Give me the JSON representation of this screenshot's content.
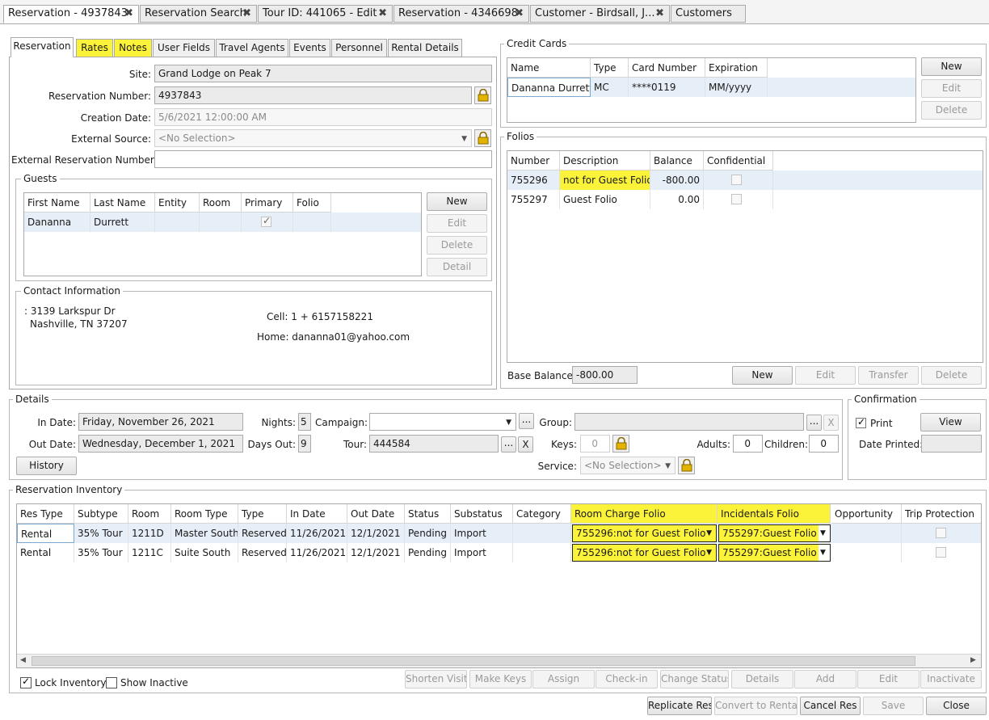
{
  "doc_tabs": [
    {
      "label": "Reservation - 4937843"
    },
    {
      "label": "Reservation Search"
    },
    {
      "label": "Tour ID: 441065 - Edit"
    },
    {
      "label": "Reservation - 4346698"
    },
    {
      "label": "Customer - Birdsall, J..."
    },
    {
      "label": "Customers"
    }
  ],
  "sub_tabs": [
    "Reservation",
    "Rates",
    "Notes",
    "User Fields",
    "Travel Agents",
    "Events",
    "Personnel",
    "Rental Details"
  ],
  "reservation": {
    "site_label": "Site:",
    "site": "Grand Lodge on Peak 7",
    "number_label": "Reservation Number:",
    "number": "4937843",
    "creation_label": "Creation Date:",
    "creation": "5/6/2021 12:00:00 AM",
    "external_source_label": "External Source:",
    "external_source": "<No Selection>",
    "external_number_label": "External Reservation Number:",
    "external_number": ""
  },
  "guests": {
    "title": "Guests",
    "columns": [
      "First Name",
      "Last Name",
      "Entity",
      "Room",
      "Primary",
      "Folio"
    ],
    "rows": [
      {
        "first": "Dananna",
        "last": "Durrett",
        "entity": "",
        "room": "",
        "primary": true,
        "folio": ""
      }
    ],
    "buttons": {
      "new": "New",
      "edit": "Edit",
      "delete": "Delete",
      "detail": "Detail"
    }
  },
  "contact": {
    "title": "Contact Information",
    "address1": ": 3139 Larkspur Dr",
    "address2": "Nashville, TN 37207",
    "cell": "Cell: 1 + 6157158221",
    "home": "Home: danan​na01@yahoo.com"
  },
  "credit_cards": {
    "title": "Credit Cards",
    "columns": [
      "Name",
      "Type",
      "Card Number",
      "Expiration"
    ],
    "rows": [
      {
        "name": "Dananna Durrett",
        "type": "MC",
        "number": "****0119",
        "expiration": "MM/yyyy"
      }
    ],
    "buttons": {
      "new": "New",
      "edit": "Edit",
      "delete": "Delete"
    }
  },
  "folios": {
    "title": "Folios",
    "columns": [
      "Number",
      "Description",
      "Balance",
      "Confidential"
    ],
    "rows": [
      {
        "number": "755296",
        "description": "not for Guest Folio",
        "balance": "-800.00"
      },
      {
        "number": "755297",
        "description": "Guest Folio",
        "balance": "0.00"
      }
    ],
    "base_balance_label": "Base Balance:",
    "base_balance": "-800.00",
    "buttons": {
      "new": "New",
      "edit": "Edit",
      "transfer": "Transfer",
      "delete": "Delete"
    }
  },
  "details": {
    "title": "Details",
    "in_date_label": "In Date:",
    "in_date": "Friday, November 26, 2021",
    "out_date_label": "Out Date:",
    "out_date": "Wednesday, December 1, 2021",
    "nights_label": "Nights:",
    "nights": "5",
    "days_out_label": "Days Out:",
    "days_out": "9",
    "campaign_label": "Campaign:",
    "campaign": "",
    "tour_label": "Tour:",
    "tour": "444584",
    "group_label": "Group:",
    "group": "",
    "keys_label": "Keys:",
    "keys": "0",
    "adults_label": "Adults:",
    "adults": "0",
    "children_label": "Children:",
    "children": "0",
    "service_label": "Service:",
    "service": "<No Selection>",
    "history_button": "History",
    "ellipsis": "...",
    "clear": "X"
  },
  "confirmation": {
    "title": "Confirmation",
    "print_label": "Print",
    "view_button": "View",
    "date_printed_label": "Date Printed:",
    "date_printed": ""
  },
  "inventory": {
    "title": "Reservation Inventory",
    "columns": [
      "Res Type",
      "Subtype",
      "Room",
      "Room Type",
      "Type",
      "In Date",
      "Out Date",
      "Status",
      "Substatus",
      "Category",
      "Room Charge Folio",
      "Incidentals Folio",
      "Opportunity",
      "Trip Protection"
    ],
    "rows": [
      {
        "res_type": "Rental",
        "subtype": "35% Tour",
        "room": "1211D",
        "room_type": "Master South",
        "type": "Reserved",
        "in_date": "11/26/2021",
        "out_date": "12/1/2021",
        "status": "Pending",
        "substatus": "Import",
        "category": "",
        "room_charge_folio": "755296:not for Guest Folio",
        "incidentals_folio": "755297:Guest Folio",
        "opportunity": ""
      },
      {
        "res_type": "Rental",
        "subtype": "35% Tour",
        "room": "1211C",
        "room_type": "Suite South",
        "type": "Reserved",
        "in_date": "11/26/2021",
        "out_date": "12/1/2021",
        "status": "Pending",
        "substatus": "Import",
        "category": "",
        "room_charge_folio": "755296:not for Guest Folio",
        "incidentals_folio": "755297:Guest Folio",
        "opportunity": ""
      }
    ],
    "lock_inventory_label": "Lock Inventory",
    "lock_inventory": true,
    "show_inactive_label": "Show Inactive",
    "show_inactive": false,
    "buttons": {
      "shorten": "Shorten Visit",
      "make_keys": "Make Keys",
      "assign": "Assign",
      "check_in": "Check-in",
      "change_status": "Change Status",
      "details": "Details",
      "add": "Add",
      "edit": "Edit",
      "inactivate": "Inactivate"
    }
  },
  "footer": {
    "replicate": "Replicate Res",
    "convert": "Convert to Rental",
    "cancel": "Cancel Res",
    "save": "Save",
    "close": "Close"
  },
  "colors": {
    "highlight": "#fbf23a",
    "selected_row": "#e6eef7",
    "border": "#a9a9a9"
  }
}
